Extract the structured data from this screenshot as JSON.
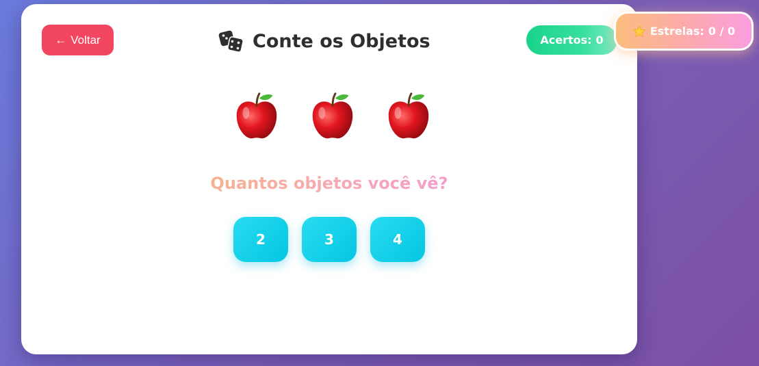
{
  "header": {
    "back_label": "Voltar",
    "title": "Conte os Objetos",
    "title_icon": "dice-icon",
    "score_label": "Acertos:",
    "score_value": "0",
    "stars_label": "Estrelas:",
    "stars_value": "0 / 0",
    "stars_icon": "star-icon"
  },
  "game": {
    "object_icon": "apple-icon",
    "object_count_shown": 3,
    "question": "Quantos objetos você vê?",
    "options": [
      "2",
      "3",
      "4"
    ]
  },
  "colors": {
    "back_button": "#f24560",
    "score_badge": "#19d48a",
    "stars_badge_start": "#fcbd7e",
    "stars_badge_end": "#fb9ee0",
    "answer_button": "#05c6e3",
    "title_text": "#2e2e2e"
  }
}
